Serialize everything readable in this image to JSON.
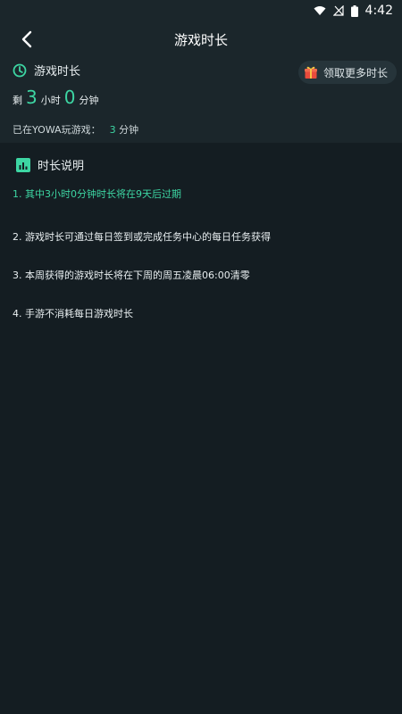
{
  "status": {
    "time": "4:42"
  },
  "header": {
    "title": "游戏时长"
  },
  "summary": {
    "label": "游戏时长",
    "claim_button": "领取更多时长",
    "remain_prefix": "剩",
    "hours": "3",
    "hours_unit": "小时",
    "minutes": "0",
    "minutes_unit": "分钟",
    "played_label": "已在YOWA玩游戏：",
    "played_value": "3",
    "played_unit": "分钟"
  },
  "explain": {
    "title": "时长说明",
    "rules": [
      "1. 其中3小时0分钟时长将在9天后过期",
      "2. 游戏时长可通过每日签到或完成任务中心的每日任务获得",
      "3. 本周获得的游戏时长将在下周的周五凌晨06:00清零",
      "4. 手游不消耗每日游戏时长"
    ]
  },
  "colors": {
    "accent": "#3dd6a3",
    "background": "#141d22",
    "panel": "#1b262b"
  },
  "icons": [
    "wifi-icon",
    "signal-icon",
    "battery-icon",
    "back-arrow-icon",
    "clock-icon",
    "gift-icon",
    "chart-icon"
  ]
}
